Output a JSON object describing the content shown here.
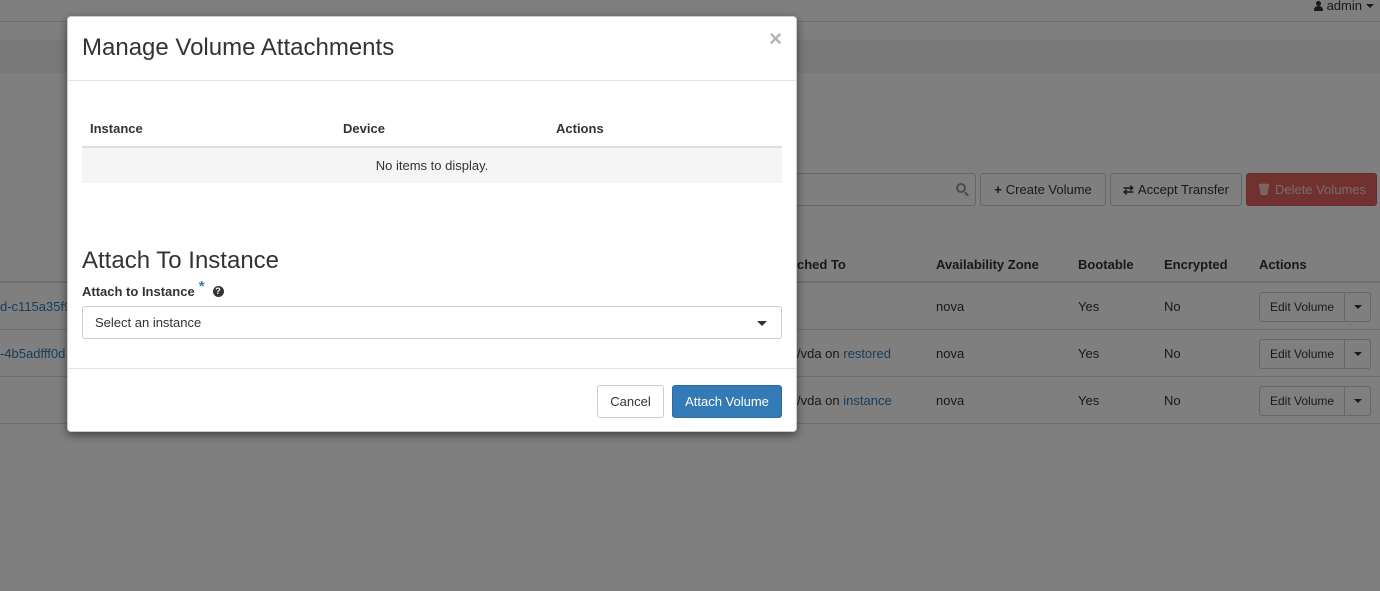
{
  "topbar": {
    "user": "admin"
  },
  "toolbar": {
    "create_label": "Create Volume",
    "create_icon": "+",
    "accept_label": "Accept Transfer",
    "accept_icon": "⇄",
    "delete_label": "Delete Volumes",
    "delete_icon": "🗑"
  },
  "volumes": {
    "headers": {
      "attached_to": "ched To",
      "availability_zone": "Availability Zone",
      "bootable": "Bootable",
      "encrypted": "Encrypted",
      "actions": "Actions"
    },
    "rows": [
      {
        "name": "d-c115a35f9",
        "attached_prefix": "",
        "attached_link": "",
        "zone": "nova",
        "bootable": "Yes",
        "encrypted": "No",
        "action": "Edit Volume"
      },
      {
        "name": "-4b5adfff0d",
        "attached_prefix": "/vda on ",
        "attached_link": "restored",
        "zone": "nova",
        "bootable": "Yes",
        "encrypted": "No",
        "action": "Edit Volume"
      },
      {
        "name": "",
        "attached_prefix": "/vda on ",
        "attached_link": "instance",
        "zone": "nova",
        "bootable": "Yes",
        "encrypted": "No",
        "action": "Edit Volume"
      }
    ]
  },
  "modal": {
    "title": "Manage Volume Attachments",
    "close": "×",
    "table": {
      "headers": {
        "instance": "Instance",
        "device": "Device",
        "actions": "Actions"
      },
      "empty": "No items to display."
    },
    "section_title": "Attach To Instance",
    "field_label": "Attach to Instance",
    "required_mark": "*",
    "help_icon": "?",
    "select_value": "Select an instance",
    "cancel_label": "Cancel",
    "attach_label": "Attach Volume"
  },
  "colors": {
    "primary": "#337ab7",
    "danger": "#d9534f",
    "link": "#337ab7"
  }
}
